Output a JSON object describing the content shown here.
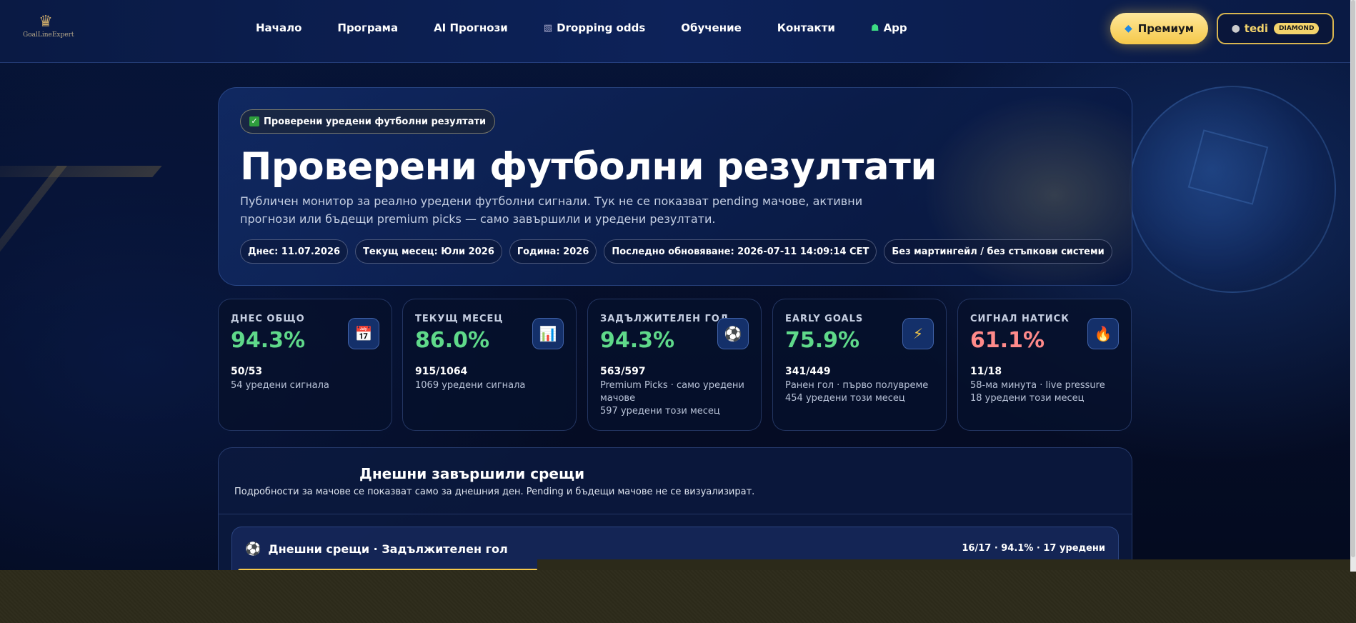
{
  "brand": {
    "logo_text": "GoalLineExpert"
  },
  "nav": {
    "links": [
      {
        "label": "Начало",
        "icon": ""
      },
      {
        "label": "Програма",
        "icon": ""
      },
      {
        "label": "AI Прогнози",
        "icon": ""
      },
      {
        "label": "Dropping odds",
        "icon": "chart-icon"
      },
      {
        "label": "Обучение",
        "icon": ""
      },
      {
        "label": "Контакти",
        "icon": ""
      },
      {
        "label": "App",
        "icon": "android-icon"
      }
    ],
    "premium_label": "Премиум",
    "user_name": "tedi",
    "user_tier": "DIAMOND"
  },
  "hero": {
    "badge": "Проверени уредени футболни резултати",
    "title": "Проверени футболни резултати",
    "description": "Публичен монитор за реално уредени футболни сигнали. Тук не се показват pending мачове, активни прогнози или бъдещи premium picks — само завършили и уредени резултати.",
    "pills": [
      "Днес: 11.07.2026",
      "Текущ месец: Юли 2026",
      "Година: 2026",
      "Последно обновяване: 2026-07-11 14:09:14 CET",
      "Без мартингейл / без стъпкови системи"
    ]
  },
  "stats": [
    {
      "label": "ДНЕС ОБЩО",
      "value": "94.3%",
      "ratio": "50/53",
      "sub": [
        "54 уредени сигнала"
      ],
      "icon": "calendar-icon",
      "tone": "green"
    },
    {
      "label": "ТЕКУЩ МЕСЕЦ",
      "value": "86.0%",
      "ratio": "915/1064",
      "sub": [
        "1069 уредени сигнала"
      ],
      "icon": "bar-chart-icon",
      "tone": "green"
    },
    {
      "label": "ЗАДЪЛЖИТЕЛЕН ГОЛ",
      "value": "94.3%",
      "ratio": "563/597",
      "sub": [
        "Premium Picks · само уредени мачове",
        "597 уредени този месец"
      ],
      "icon": "soccer-ball-icon",
      "tone": "green"
    },
    {
      "label": "EARLY GOALS",
      "value": "75.9%",
      "ratio": "341/449",
      "sub": [
        "Ранен гол · първо полувреме",
        "454 уредени този месец"
      ],
      "icon": "lightning-icon",
      "tone": "green"
    },
    {
      "label": "СИГНАЛ НАТИСК",
      "value": "61.1%",
      "ratio": "11/18",
      "sub": [
        "58-ма минута · live pressure",
        "18 уредени този месец"
      ],
      "icon": "fire-icon",
      "tone": "red"
    }
  ],
  "today": {
    "title": "Днешни завършили срещи",
    "subtitle": "Подробности за мачове се показват само за днешния ден. Pending и бъдещи мачове не се визуализират.",
    "group_title": "Днешни срещи · Задължителен гол",
    "group_stats": "16/17 · 94.1% · 17 уредени"
  },
  "colors": {
    "accent_gold": "#f5c84a",
    "positive": "#5fd98a",
    "negative": "#ff8a8a",
    "bg": "#061030"
  }
}
